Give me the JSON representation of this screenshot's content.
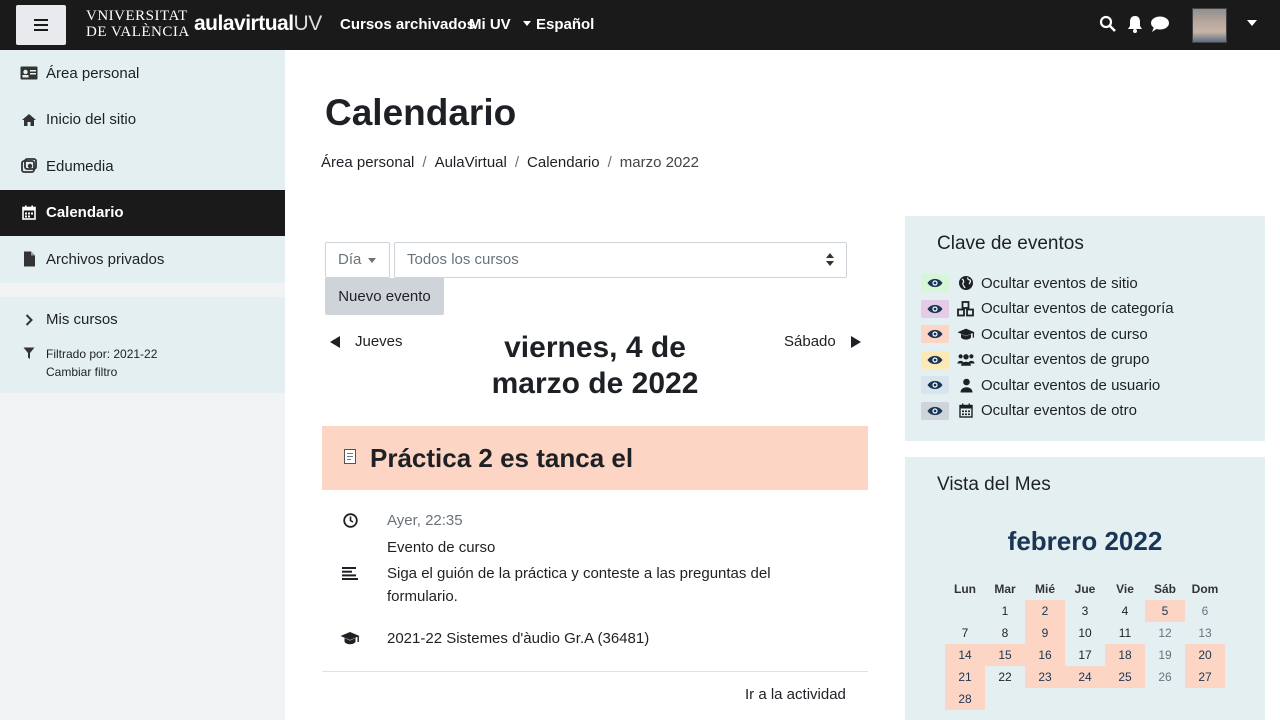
{
  "navbar": {
    "logo_uv_line1": "VNIVERSITAT",
    "logo_uv_line2": "DE VALÈNCIA",
    "logo_av_main": "aulavirtual",
    "logo_av_suffix": "UV",
    "links": [
      "Cursos archivados",
      "Mi UV",
      "Español"
    ]
  },
  "sidebar": {
    "items": [
      {
        "label": "Área personal",
        "icon": "id-card-icon"
      },
      {
        "label": "Inicio del sitio",
        "icon": "home-icon"
      },
      {
        "label": "Edumedia",
        "icon": "media-icon"
      },
      {
        "label": "Calendario",
        "icon": "calendar-icon",
        "active": true
      },
      {
        "label": "Archivos privados",
        "icon": "file-icon"
      }
    ],
    "mis_cursos": "Mis cursos",
    "filter_line1": "Filtrado por: 2021-22",
    "filter_line2": "Cambiar filtro"
  },
  "main": {
    "title": "Calendario",
    "breadcrumb": [
      "Área personal",
      "AulaVirtual",
      "Calendario",
      "marzo 2022"
    ],
    "view_select": "Día",
    "course_select": "Todos los cursos",
    "new_event": "Nuevo evento",
    "prev_day": "Jueves",
    "next_day": "Sábado",
    "day_title": "viernes, 4 de marzo de 2022"
  },
  "event": {
    "name": "Práctica 2 es tanca el",
    "time": "Ayer, 22:35",
    "type": "Evento de curso",
    "description_line1": "Siga el guión de la práctica y conteste a las preguntas del",
    "description_line2": "formulario.",
    "course": "2021-22 Sistemes d'àudio Gr.A (36481)",
    "link": "Ir a la actividad"
  },
  "event_key": {
    "title": "Clave de eventos",
    "rows": [
      {
        "label": "Ocultar eventos de sitio",
        "color": "#d7f5d7",
        "icon": "globe-icon"
      },
      {
        "label": "Ocultar eventos de categoría",
        "color": "#e6cbe6",
        "icon": "cubes-icon"
      },
      {
        "label": "Ocultar eventos de curso",
        "color": "#fdd5c4",
        "icon": "graduation-cap-icon"
      },
      {
        "label": "Ocultar eventos de grupo",
        "color": "#fde9b6",
        "icon": "users-icon"
      },
      {
        "label": "Ocultar eventos de usuario",
        "color": "#d9e5ee",
        "icon": "user-icon"
      },
      {
        "label": "Ocultar eventos de otro",
        "color": "#ced4da",
        "icon": "calendar-icon"
      }
    ]
  },
  "month_view": {
    "title": "Vista del Mes",
    "month": "febrero 2022",
    "weekdays": [
      "Lun",
      "Mar",
      "Mié",
      "Jue",
      "Vie",
      "Sáb",
      "Dom"
    ],
    "leading_blanks": 0,
    "days": [
      {
        "d": "",
        "ev": false
      },
      {
        "d": "1",
        "ev": false
      },
      {
        "d": "2",
        "ev": true
      },
      {
        "d": "3",
        "ev": false
      },
      {
        "d": "4",
        "ev": false
      },
      {
        "d": "5",
        "ev": true
      },
      {
        "d": "6",
        "ev": false
      },
      {
        "d": "7",
        "ev": false
      },
      {
        "d": "8",
        "ev": false
      },
      {
        "d": "9",
        "ev": true
      },
      {
        "d": "10",
        "ev": false
      },
      {
        "d": "11",
        "ev": false
      },
      {
        "d": "12",
        "ev": false
      },
      {
        "d": "13",
        "ev": false
      },
      {
        "d": "14",
        "ev": true
      },
      {
        "d": "15",
        "ev": true
      },
      {
        "d": "16",
        "ev": true
      },
      {
        "d": "17",
        "ev": false
      },
      {
        "d": "18",
        "ev": true
      },
      {
        "d": "19",
        "ev": false
      },
      {
        "d": "20",
        "ev": true
      },
      {
        "d": "21",
        "ev": true
      },
      {
        "d": "22",
        "ev": false
      },
      {
        "d": "23",
        "ev": true
      },
      {
        "d": "24",
        "ev": true
      },
      {
        "d": "25",
        "ev": true
      },
      {
        "d": "26",
        "ev": false
      },
      {
        "d": "27",
        "ev": true
      },
      {
        "d": "28",
        "ev": true
      }
    ]
  }
}
